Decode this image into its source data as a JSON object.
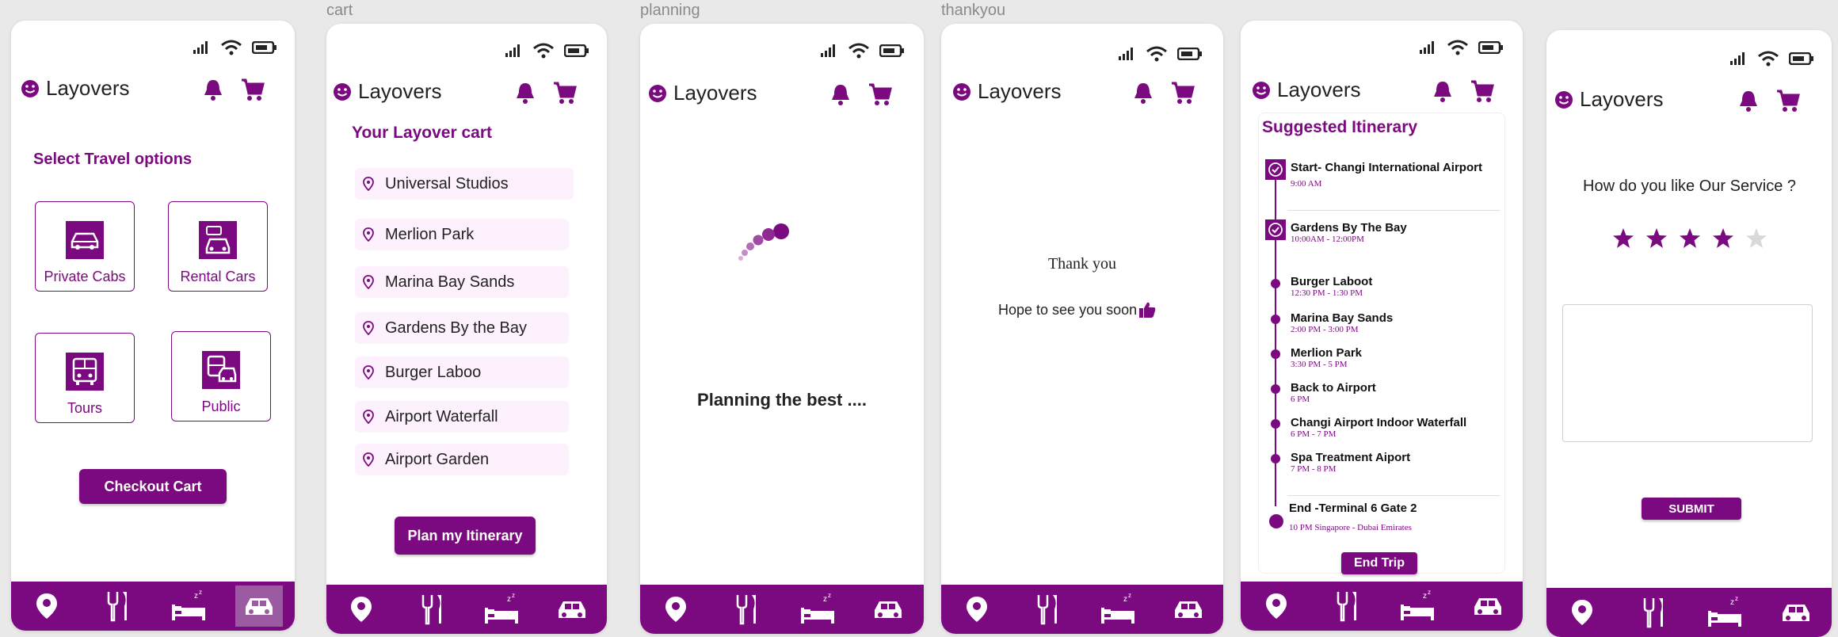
{
  "frame_captions": [
    "cart",
    "planning",
    "thankyou"
  ],
  "app": {
    "brand": "Layovers",
    "accent": "#7b0a80"
  },
  "screen1": {
    "heading": "Select Travel options",
    "options": [
      {
        "label": "Private Cabs",
        "icon": "car-icon"
      },
      {
        "label": "Rental Cars",
        "icon": "rental-car-icon"
      },
      {
        "label": "Tours",
        "icon": "bus-icon"
      },
      {
        "label": "Public",
        "icon": "train-icon"
      }
    ],
    "checkout_label": "Checkout Cart"
  },
  "screen2": {
    "heading": "Your Layover cart",
    "items": [
      "Universal Studios",
      "Merlion Park",
      "Marina Bay Sands",
      "Gardens By the Bay",
      "Burger Laboo",
      "Airport Waterfall",
      "Airport Garden"
    ],
    "plan_label": "Plan my Itinerary"
  },
  "screen3": {
    "message": "Planning the best ...."
  },
  "screen4": {
    "thank_you": "Thank you",
    "hope": "Hope to see you soon"
  },
  "screen5": {
    "heading": "Suggested Itinerary",
    "start": {
      "title": "Start- Changi International Airport",
      "time": "9:00 AM"
    },
    "first": {
      "title": "Gardens  By  The  Bay",
      "time": "10:00AM - 12:00PM"
    },
    "stops": [
      {
        "title": "Burger Laboot",
        "time": "12:30 PM - 1:30 PM"
      },
      {
        "title": "Marina Bay Sands",
        "time": "2:00 PM - 3:00 PM"
      },
      {
        "title": "Merlion Park",
        "time": "3:30 PM - 5 PM"
      },
      {
        "title": "Back to Airport",
        "time": "6 PM"
      },
      {
        "title": "Changi Airport Indoor Waterfall",
        "time": "6 PM - 7 PM"
      },
      {
        "title": "Spa Treatment  Aiport",
        "time": "7 PM - 8 PM"
      }
    ],
    "end": {
      "title": "End -Terminal 6  Gate 2",
      "time": "10 PM Singapore - Dubai  Emirates"
    },
    "end_trip_label": "End Trip"
  },
  "screen6": {
    "question": "How do you like Our Service ?",
    "rating": 4,
    "rating_max": 5,
    "submit_label": "SUBMIT"
  },
  "nav": [
    "location-icon",
    "dining-icon",
    "sleep-icon",
    "car-icon"
  ]
}
